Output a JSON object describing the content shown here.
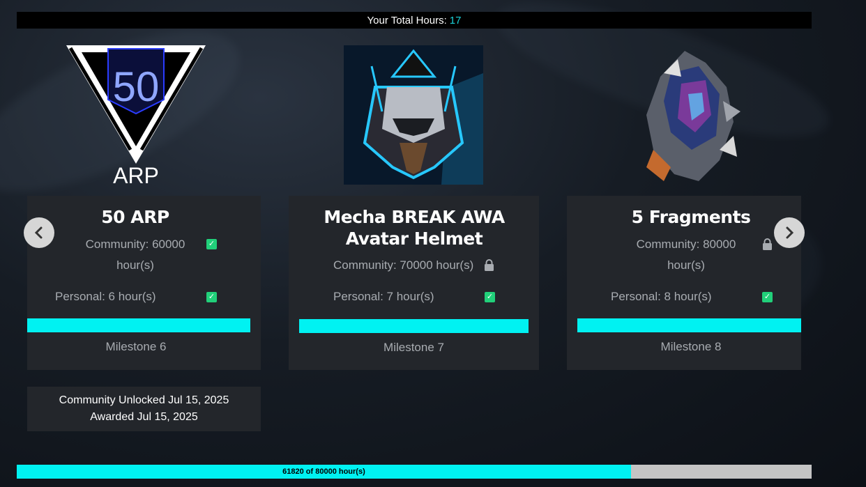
{
  "header": {
    "label": "Your Total Hours:",
    "value": "17"
  },
  "rewards": [
    {
      "image": "arp-badge-icon",
      "title": "50 ARP",
      "community_label": "Community: 60000",
      "community_label_cont": "hour(s)",
      "community_status": "checked",
      "personal_label": "Personal: 6 hour(s)",
      "personal_status": "checked",
      "milestone": "Milestone 6",
      "badge_text": "50",
      "logo_text": "ARP"
    },
    {
      "image": "mecha-helmet-image",
      "title_line1": "Mecha BREAK AWA",
      "title_line2": "Avatar Helmet",
      "community_label": "Community: 70000 hour(s)",
      "community_status": "locked",
      "personal_label": "Personal: 7 hour(s)",
      "personal_status": "checked",
      "milestone": "Milestone 7"
    },
    {
      "image": "crystal-fragment-image",
      "title": "5 Fragments",
      "community_label": "Community: 80000",
      "community_label_cont": "hour(s)",
      "community_status": "locked",
      "personal_label": "Personal: 8 hour(s)",
      "personal_status": "checked",
      "milestone": "Milestone 8"
    }
  ],
  "unlock_info": {
    "line1": "Community Unlocked Jul 15, 2025",
    "line2": "Awarded Jul 15, 2025"
  },
  "community_progress": {
    "label": "61820 of 80000 hour(s)",
    "current": 61820,
    "total": 80000
  },
  "colors": {
    "accent": "#00f2f2",
    "check": "#21d07a",
    "card_bg": "#23262b",
    "hours_value": "#1ad1d8"
  }
}
